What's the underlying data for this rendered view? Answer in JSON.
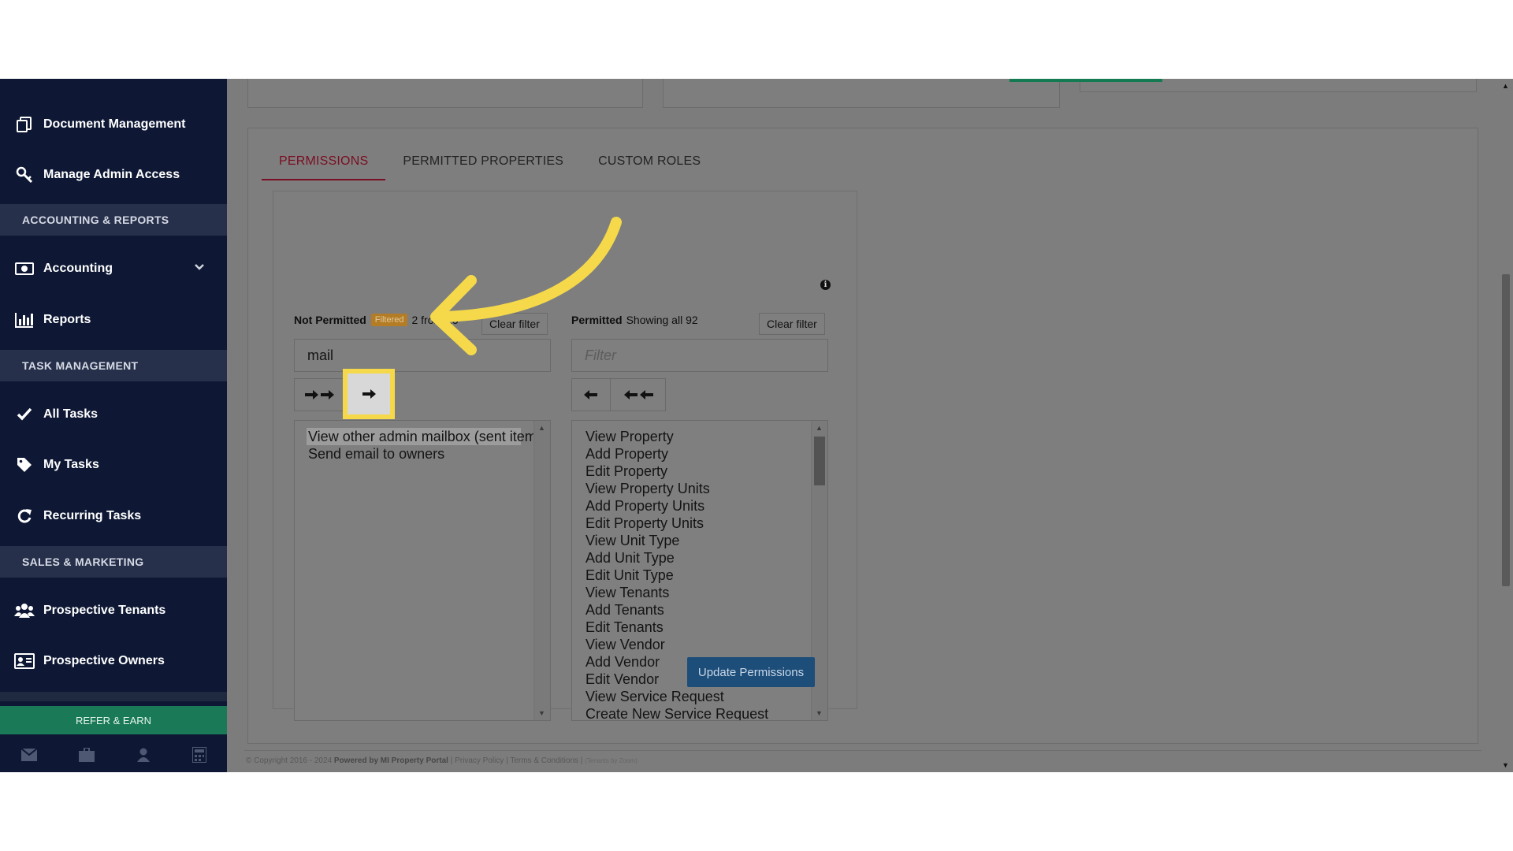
{
  "sidebar": {
    "items": [
      {
        "label": "Document Management",
        "icon": "document-copy-icon"
      },
      {
        "label": "Manage Admin Access",
        "icon": "key-icon"
      }
    ],
    "section_accounting": "ACCOUNTING & REPORTS",
    "accounting": {
      "label": "Accounting",
      "icon": "money-icon"
    },
    "reports": {
      "label": "Reports",
      "icon": "bar-chart-icon"
    },
    "section_tasks": "TASK MANAGEMENT",
    "all_tasks": {
      "label": "All Tasks",
      "icon": "check-icon"
    },
    "my_tasks": {
      "label": "My Tasks",
      "icon": "tag-icon"
    },
    "recurring_tasks": {
      "label": "Recurring Tasks",
      "icon": "refresh-icon"
    },
    "section_sales": "SALES & MARKETING",
    "prospective_tenants": {
      "label": "Prospective Tenants",
      "icon": "users-icon"
    },
    "prospective_owners": {
      "label": "Prospective Owners",
      "icon": "id-card-icon"
    },
    "refer_label": "REFER & EARN",
    "bottom_icons": [
      "envelope-icon",
      "briefcase-icon",
      "user-icon",
      "calculator-icon"
    ]
  },
  "tabs": [
    {
      "label": "PERMISSIONS",
      "active": true
    },
    {
      "label": "PERMITTED PROPERTIES",
      "active": false
    },
    {
      "label": "CUSTOM ROLES",
      "active": false
    }
  ],
  "not_permitted": {
    "title": "Not Permitted",
    "badge": "Filtered",
    "count_text": "2 from 25",
    "clear_label": "Clear filter",
    "filter_value": "mail",
    "items": [
      "View other admin mailbox (sent item",
      "Send email to owners"
    ]
  },
  "permitted": {
    "title": "Permitted",
    "count_text": "Showing all 92",
    "clear_label": "Clear filter",
    "filter_placeholder": "Filter",
    "items": [
      "View Property",
      "Add Property",
      "Edit Property",
      "View Property Units",
      "Add Property Units",
      "Edit Property Units",
      "View Unit Type",
      "Add Unit Type",
      "Edit Unit Type",
      "View Tenants",
      "Add Tenants",
      "Edit Tenants",
      "View Vendor",
      "Add Vendor",
      "Edit Vendor",
      "View Service Request",
      "Create New Service Request"
    ]
  },
  "move_buttons": {
    "move_all_right": "➜➜",
    "move_selected_right": "➜",
    "move_selected_left": "⬅",
    "move_all_left": "⬅⬅"
  },
  "update_label": "Update Permissions",
  "footer": {
    "copyright": "© Copyright 2016 - 2024",
    "powered": "Powered by MI Property Portal",
    "privacy": "Privacy Policy",
    "terms": "Terms & Conditions",
    "tenants_by": "(Tenants by Zoom)"
  },
  "colors": {
    "accent_tab": "#7a0e22",
    "sidebar_bg": "#0e1834",
    "highlight": "#f5d94a",
    "update_button": "#1d4e7a",
    "refer_button": "#1a7a57"
  }
}
